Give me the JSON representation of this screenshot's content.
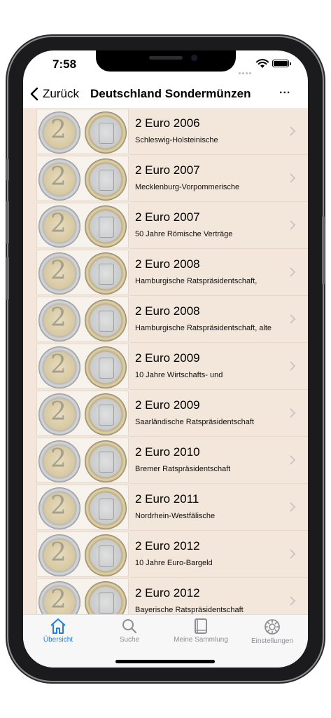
{
  "status": {
    "time": "7:58"
  },
  "nav": {
    "back_label": "Zurück",
    "title": "Deutschland Sondermünzen",
    "more_label": "..."
  },
  "colors": {
    "accent": "#1e7cf2",
    "row_background": "#f3e6da"
  },
  "rows": [
    {
      "title": "2 Euro 2006",
      "subtitle": "Schleswig-Holsteinische"
    },
    {
      "title": "2 Euro 2007",
      "subtitle": "Mecklenburg-Vorpommerische"
    },
    {
      "title": "2 Euro 2007",
      "subtitle": "50 Jahre Römische Verträge"
    },
    {
      "title": "2 Euro 2008",
      "subtitle": "Hamburgische Ratspräsidentschaft,"
    },
    {
      "title": "2 Euro 2008",
      "subtitle": "Hamburgische Ratspräsidentschaft, alte"
    },
    {
      "title": "2 Euro 2009",
      "subtitle": "10 Jahre Wirtschafts- und"
    },
    {
      "title": "2 Euro 2009",
      "subtitle": "Saarländische Ratspräsidentschaft"
    },
    {
      "title": "2 Euro 2010",
      "subtitle": "Bremer Ratspräsidentschaft"
    },
    {
      "title": "2 Euro 2011",
      "subtitle": "Nordrhein-Westfälische"
    },
    {
      "title": "2 Euro 2012",
      "subtitle": "10 Jahre Euro-Bargeld"
    },
    {
      "title": "2 Euro 2012",
      "subtitle": "Bayerische Ratspräsidentschaft"
    }
  ],
  "tabs": [
    {
      "label": "Übersicht",
      "icon": "house-icon",
      "active": true
    },
    {
      "label": "Suche",
      "icon": "magnifier-icon",
      "active": false
    },
    {
      "label": "Meine Sammlung",
      "icon": "book-icon",
      "active": false
    },
    {
      "label": "Einstellungen",
      "icon": "gear-icon",
      "active": false
    }
  ]
}
